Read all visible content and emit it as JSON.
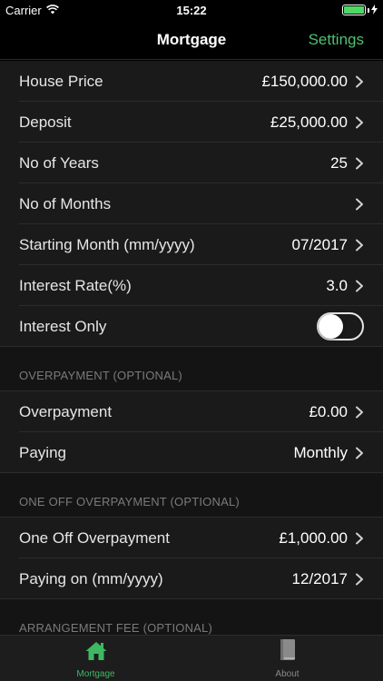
{
  "status": {
    "carrier": "Carrier",
    "time": "15:22"
  },
  "nav": {
    "title": "Mortgage",
    "settings_label": "Settings"
  },
  "rows": [
    {
      "label": "House Price",
      "value": "£150,000.00"
    },
    {
      "label": "Deposit",
      "value": "£25,000.00"
    },
    {
      "label": "No of Years",
      "value": "25"
    },
    {
      "label": "No of Months",
      "value": ""
    },
    {
      "label": "Starting Month (mm/yyyy)",
      "value": "07/2017"
    },
    {
      "label": "Interest Rate(%)",
      "value": "3.0"
    },
    {
      "label": "Interest Only",
      "toggle_on": false
    }
  ],
  "sections": {
    "overpayment": {
      "header": "OVERPAYMENT (OPTIONAL)",
      "rows": [
        {
          "label": "Overpayment",
          "value": "£0.00"
        },
        {
          "label": "Paying",
          "value": "Monthly"
        }
      ]
    },
    "one_off": {
      "header": "ONE OFF OVERPAYMENT (OPTIONAL)",
      "rows": [
        {
          "label": "One Off Overpayment",
          "value": "£1,000.00"
        },
        {
          "label": "Paying on (mm/yyyy)",
          "value": "12/2017"
        }
      ]
    },
    "arrangement_fee": {
      "header": "ARRANGEMENT FEE (OPTIONAL)"
    }
  },
  "tabs": [
    {
      "label": "Mortgage",
      "icon": "house-icon",
      "active": true
    },
    {
      "label": "About",
      "icon": "book-icon",
      "active": false
    }
  ],
  "colors": {
    "accent": "#4fc06f",
    "battery": "#4cd964",
    "background": "#1a1a1a"
  }
}
